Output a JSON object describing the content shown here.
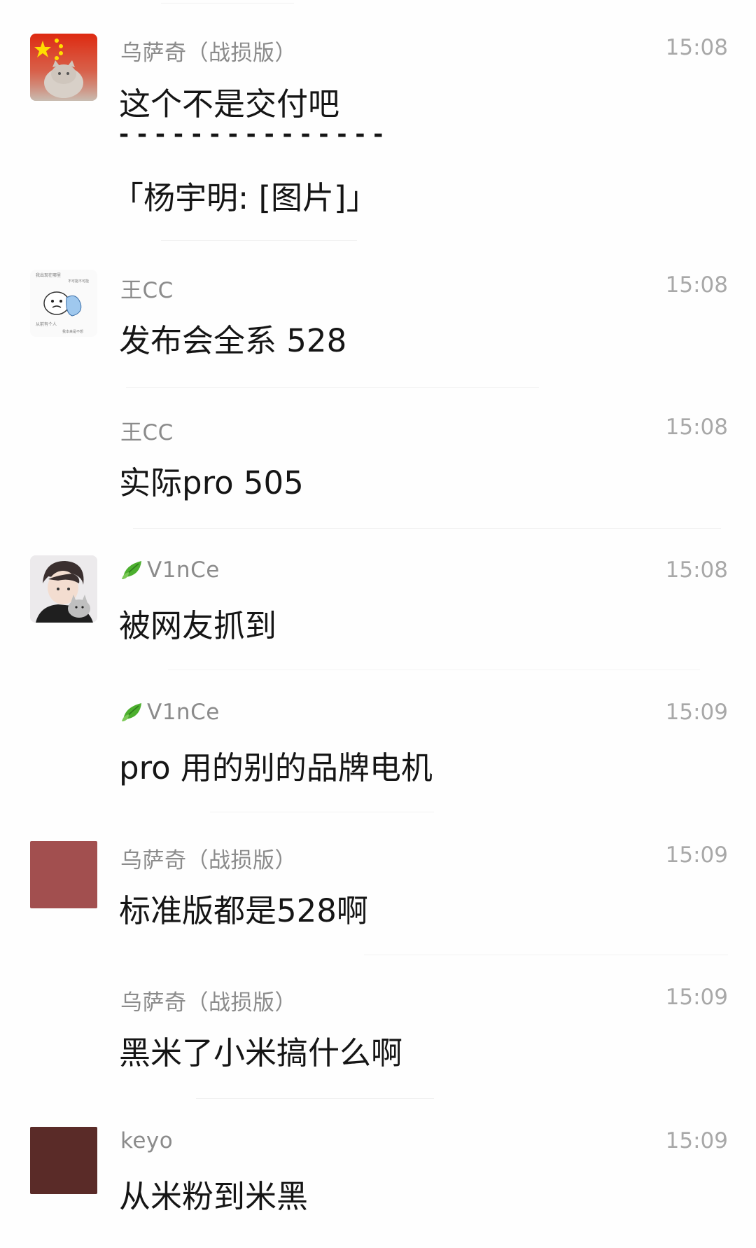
{
  "messages": [
    {
      "sender": "乌萨奇（战损版）",
      "time": "15:08",
      "lines": [
        "这个不是交付吧",
        "- - - - - - - - - - - - - - -",
        "「杨宇明: [图片]」"
      ]
    },
    {
      "sender": "王CC",
      "time": "15:08",
      "text": "发布会全系 528"
    },
    {
      "sender": "王CC",
      "time": "15:08",
      "text": "实际pro 505"
    },
    {
      "sender": "V1nCe",
      "time": "15:08",
      "text": "被网友抓到"
    },
    {
      "sender": "V1nCe",
      "time": "15:09",
      "text": "pro 用的别的品牌电机"
    },
    {
      "sender": "乌萨奇（战损版）",
      "time": "15:09",
      "text": "标准版都是528啊"
    },
    {
      "sender": "乌萨奇（战损版）",
      "time": "15:09",
      "text": "黑米了小米搞什么啊"
    },
    {
      "sender": "keyo",
      "time": "15:09",
      "text": "从米粉到米黑"
    }
  ],
  "sticker_text": {
    "line1": "我出现在哪里",
    "line2": "不可能不可能",
    "line3": "从前有个人",
    "line4": "我本来是不想"
  },
  "colors": {
    "avatar_usaqi_solid": "#a24f4f",
    "avatar_keyo": "#5a2b28",
    "flag_red": "#de2910",
    "flag_star": "#ffde00",
    "leaf_green": "#4caf2e"
  }
}
